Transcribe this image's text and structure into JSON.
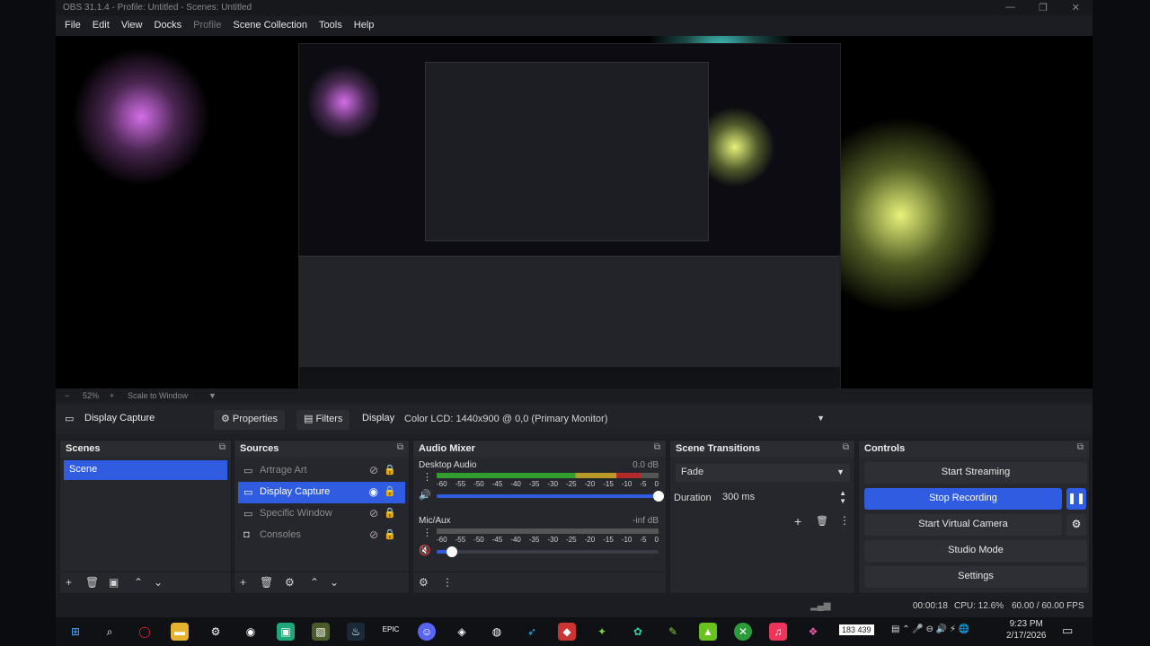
{
  "window": {
    "title": "OBS 31.1.4 - Profile: Untitled - Scenes: Untitled",
    "minimize": "—",
    "maximize": "❐",
    "close": "✕"
  },
  "menu": [
    "File",
    "Edit",
    "View",
    "Docks",
    "Profile",
    "Scene Collection",
    "Tools",
    "Help"
  ],
  "zoom": {
    "minus": "−",
    "percent": "52%",
    "plus": "+",
    "scale_mode": "Scale to Window"
  },
  "source_toolbar": {
    "source_name": "Display Capture",
    "properties_label": "Properties",
    "filters_label": "Filters",
    "display_label": "Display",
    "display_value": "Color LCD: 1440x900 @ 0,0 (Primary Monitor)"
  },
  "scenes": {
    "title": "Scenes",
    "items": [
      "Scene"
    ]
  },
  "sources": {
    "title": "Sources",
    "items": [
      {
        "name": "Artrage Art",
        "icon": "window-icon",
        "selected": false
      },
      {
        "name": "Display Capture",
        "icon": "monitor-icon",
        "selected": true
      },
      {
        "name": "Specific Window",
        "icon": "window-icon",
        "selected": false
      },
      {
        "name": "Consoles",
        "icon": "camera-icon",
        "selected": false
      }
    ]
  },
  "audio_mixer": {
    "title": "Audio Mixer",
    "channels": [
      {
        "name": "Desktop Audio",
        "db": "0.0 dB",
        "level": 0.92,
        "volume": 1.0
      },
      {
        "name": "Mic/Aux",
        "db": "-inf dB",
        "level": 0.0,
        "volume": 0.07
      }
    ],
    "ticks": [
      "-60",
      "-55",
      "-50",
      "-45",
      "-40",
      "-35",
      "-30",
      "-25",
      "-20",
      "-15",
      "-10",
      "-5",
      "0"
    ]
  },
  "transitions": {
    "title": "Scene Transitions",
    "type": "Fade",
    "duration_label": "Duration",
    "duration_value": "300 ms"
  },
  "controls": {
    "title": "Controls",
    "start_streaming": "Start Streaming",
    "stop_recording": "Stop Recording",
    "start_virtual_camera": "Start Virtual Camera",
    "studio_mode": "Studio Mode",
    "settings": "Settings"
  },
  "status": {
    "rec_time": "00:00:18",
    "cpu": "CPU: 12.6%",
    "fps": "60.00 / 60.00 FPS"
  },
  "taskbar": {
    "badge": "183 439",
    "time": "9:23 PM",
    "date": "2/17/2026"
  },
  "colors": {
    "accent": "#2f5ce0",
    "meter_green": "#2f9e2f",
    "meter_yellow": "#b99a26",
    "meter_red": "#b22a2a"
  }
}
